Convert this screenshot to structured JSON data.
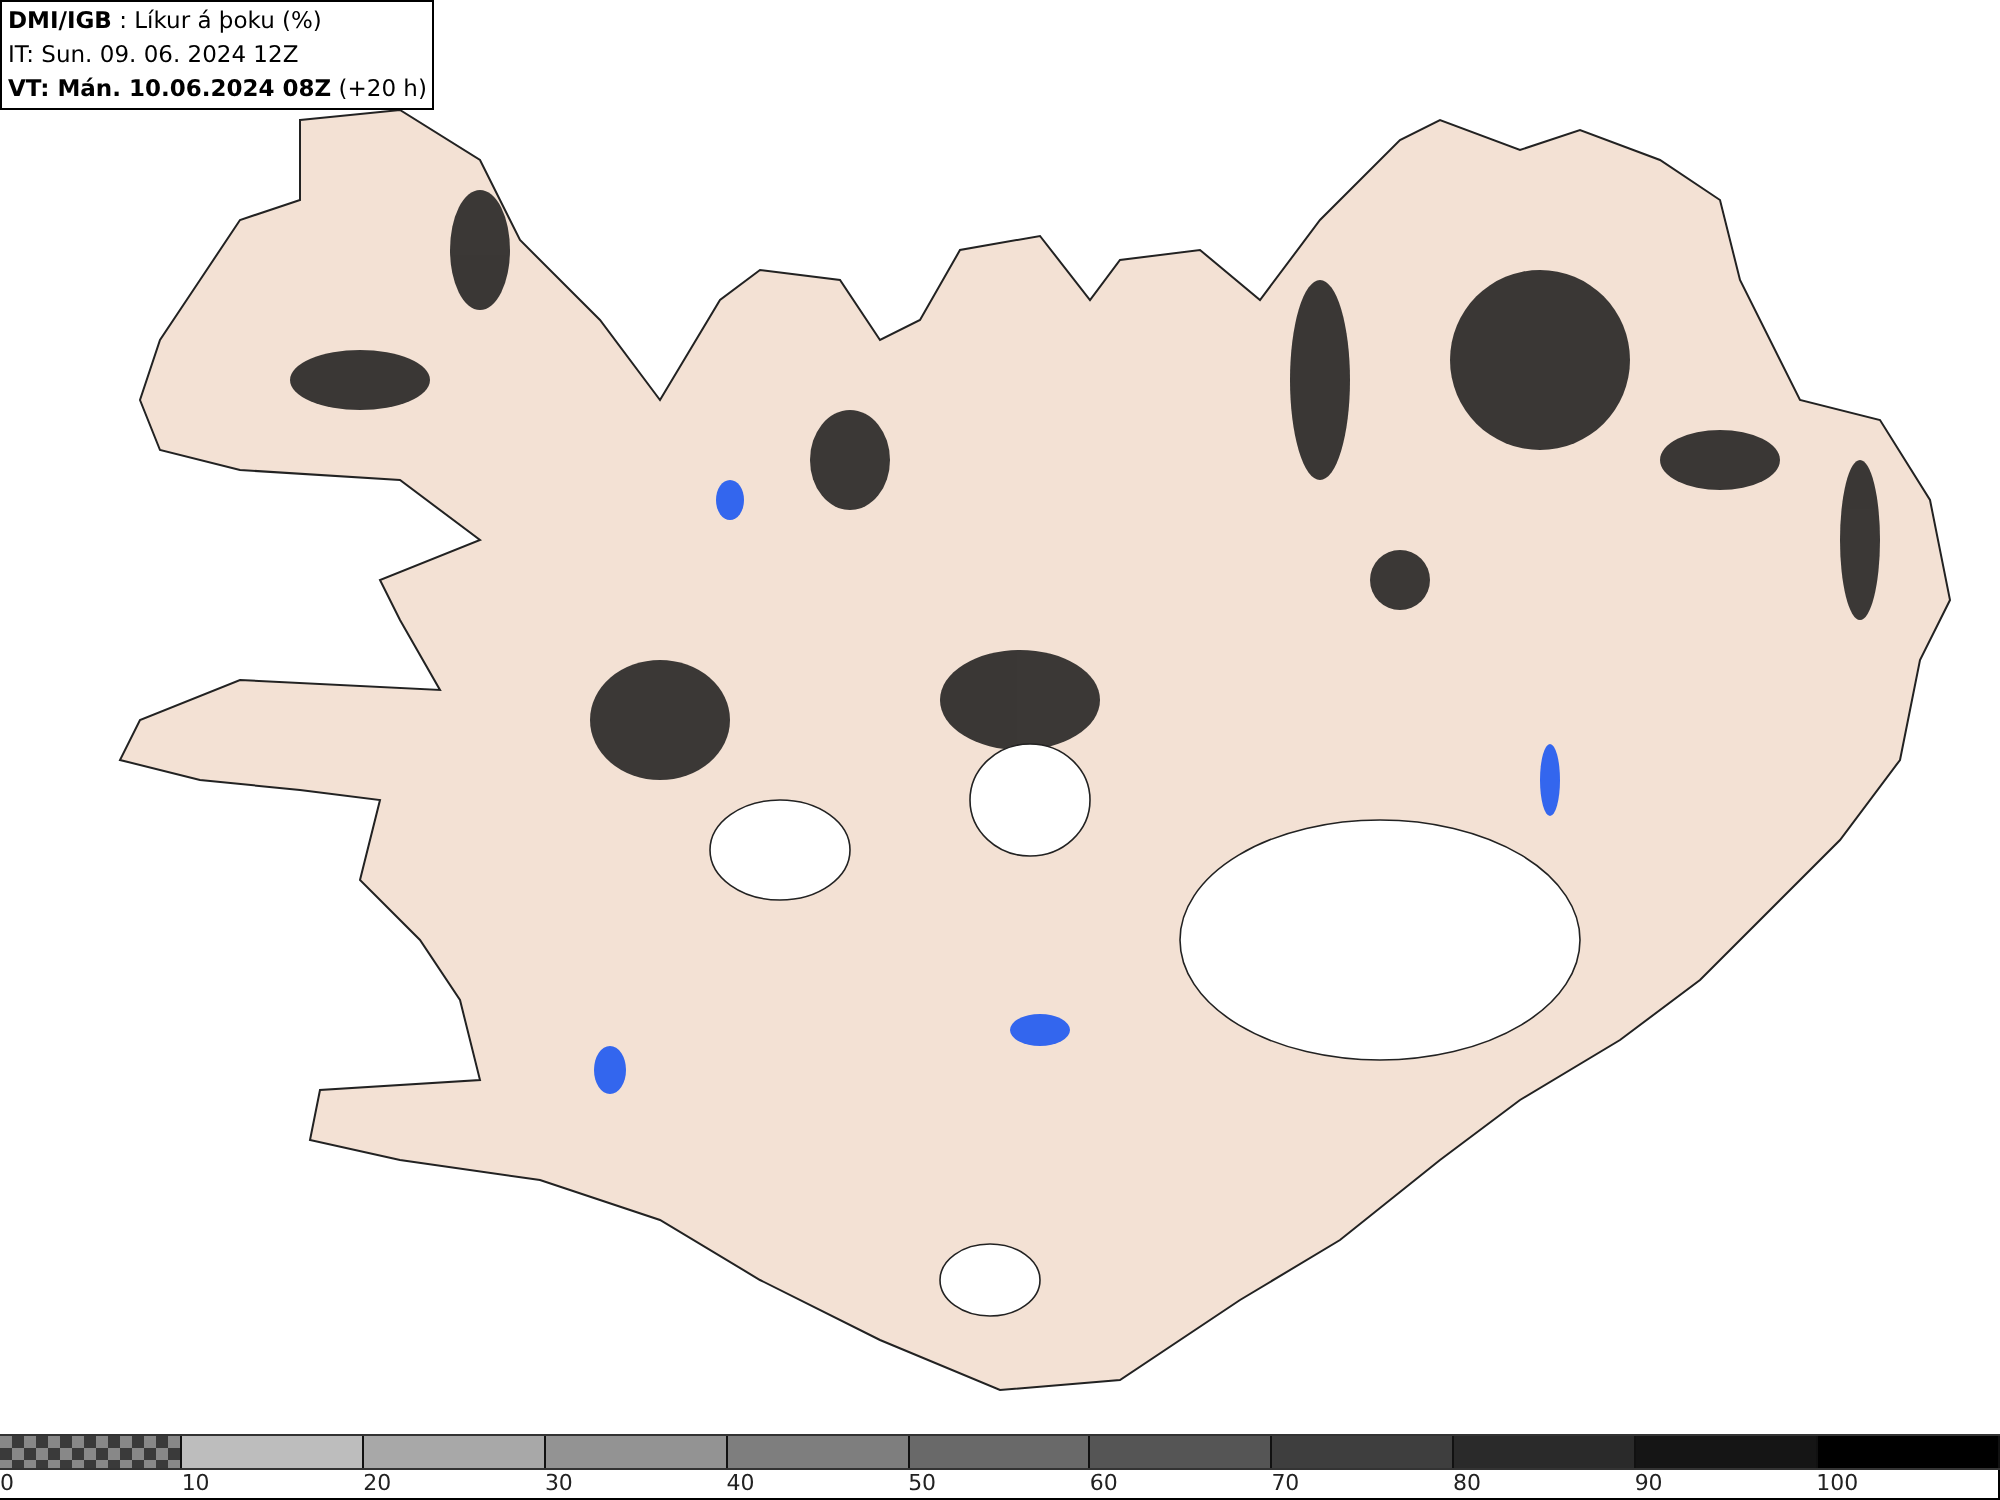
{
  "header": {
    "lines": [
      "**DMI/IGB** : Líkur á þoku (%)",
      "IT: Sun. 09. 06. 2024 12Z",
      "**VT: Mán. 10.06.2024 08Z** (+20 h)"
    ]
  },
  "legend": {
    "segments": [
      {
        "kind": "checker",
        "color": "#3a3a3a"
      },
      {
        "kind": "solid",
        "color": "#bdbdbd"
      },
      {
        "kind": "solid",
        "color": "#a8a8a8"
      },
      {
        "kind": "solid",
        "color": "#939393"
      },
      {
        "kind": "solid",
        "color": "#7e7e7e"
      },
      {
        "kind": "solid",
        "color": "#696969"
      },
      {
        "kind": "solid",
        "color": "#555555"
      },
      {
        "kind": "solid",
        "color": "#3e3e3e"
      },
      {
        "kind": "solid",
        "color": "#2a2a2a"
      },
      {
        "kind": "solid",
        "color": "#151515"
      },
      {
        "kind": "solid",
        "color": "#000000"
      }
    ],
    "labels": [
      "0",
      "10",
      "20",
      "30",
      "40",
      "50",
      "60",
      "70",
      "80",
      "90",
      "100"
    ]
  }
}
